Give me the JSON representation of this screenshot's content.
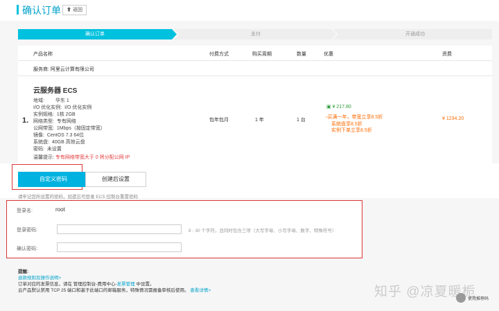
{
  "header": {
    "title": "确认订单",
    "back_label": "返回"
  },
  "steps": [
    {
      "label": "确认订单",
      "active": true
    },
    {
      "label": "支付",
      "active": false
    },
    {
      "label": "开通成功",
      "active": false
    }
  ],
  "table": {
    "columns": [
      "产品名称",
      "付费方式",
      "购买周期",
      "数量",
      "优惠",
      "资费"
    ],
    "vendor": "服务商: 阿里云计算有限公司",
    "row_index": "1.",
    "product_name": "云服务器 ECS",
    "specs": [
      {
        "k": "地域:",
        "v": "华东 1"
      },
      {
        "k": "I/O 优化实例:",
        "v": "I/O 优化实例"
      },
      {
        "k": "实例规格:",
        "v": "1核 2GB"
      },
      {
        "k": "网络类型:",
        "v": "专有网络"
      },
      {
        "k": "公网带宽:",
        "v": "1Mbps（按固定带宽）"
      },
      {
        "k": "镜像:",
        "v": "CentOS 7.3 64位"
      },
      {
        "k": "系统盘:",
        "v": "40GB 高效云盘"
      },
      {
        "k": "密码:",
        "v": "未设置"
      }
    ],
    "tip_label": "温馨提示:",
    "tip_text": "专有网络带宽大于 0 将分配公网 IP",
    "pay_method": "包年包月",
    "period": "1 年",
    "quantity": "1 台",
    "discount_amount": "¥ 217.80",
    "discounts": [
      "买满一年，带宽立享8.5折",
      "系统盘享8.5折",
      "实例下单立享8.5折"
    ],
    "price": "¥ 1234.20"
  },
  "buttons": {
    "custom_password": "自定义密码",
    "set_later": "创建后设置"
  },
  "note": "请牢记您所设置的密码，如遗忘可登录 ECS 控制台重置密码",
  "form": {
    "login_label": "登录名:",
    "login_value": "root",
    "password_label": "登录密码:",
    "password_hint": "8 - 30 个字符，且同时包含三项（大写字母、小写字母、数字、特殊符号）",
    "confirm_label": "确认密码:"
  },
  "footer": {
    "heading": "提醒:",
    "link1": "退款规则及操作说明>",
    "line2_pre": "订单对应的发票信息，请在 管理控制台-费用中心-",
    "line2_link": "发票管理",
    "line2_post": " 中设置。",
    "line3_pre": "云产品默认禁用 TCP 25 端口和基于此端口的邮箱服务，特殊情况需报备审核后使用。",
    "line3_link": "查看详情>"
  },
  "watermark": {
    "main": "知乎 @凉夏暖栀",
    "sub": "使用推荐码"
  },
  "colors": {
    "accent": "#00c1de",
    "orange": "#ff6a00",
    "green": "#2a9d3a",
    "red_box": "#dd3333"
  }
}
